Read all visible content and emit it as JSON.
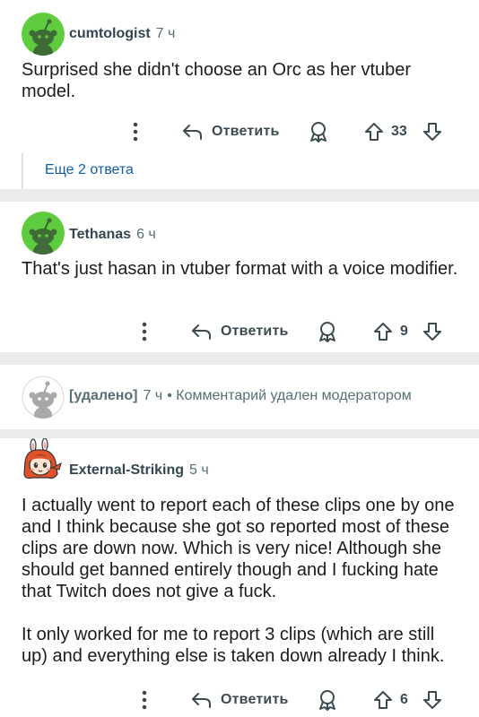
{
  "comments": [
    {
      "username": "cumtologist",
      "time": "7 ч",
      "text": "Surprised she didn't choose an Orc as her vtuber model.",
      "reply_label": "Ответить",
      "score": "33",
      "more_replies": "Еще 2 ответа"
    },
    {
      "username": "Tethanas",
      "time": "6 ч",
      "text": "That's just hasan in vtuber format with a voice modifier.",
      "reply_label": "Ответить",
      "score": "9"
    },
    {
      "username": "[удалено]",
      "time": "7 ч",
      "note": "• Комментарий удален модератором"
    },
    {
      "username": "External-Striking",
      "time": "5 ч",
      "paragraphs": [
        "I actually went to report each of these clips one by one and I think because she got so reported most of these clips are down now. Which is very nice! Although she should get banned entirely though and I fucking hate that Twitch does not give a fuck.",
        "It only worked for me to report 3 clips (which are still up) and everything else is taken down already I think."
      ],
      "reply_label": "Ответить",
      "score": "6"
    }
  ],
  "icons": [
    "snoo-avatar-icon",
    "more-vert-icon",
    "reply-arrow-icon",
    "award-icon",
    "upvote-icon",
    "downvote-icon"
  ],
  "colors": {
    "avatar_green": "#5fcc40",
    "link_blue": "#0f5ea8",
    "meta_gray": "#576f76",
    "username": "#33464f",
    "background": "#ececec"
  }
}
